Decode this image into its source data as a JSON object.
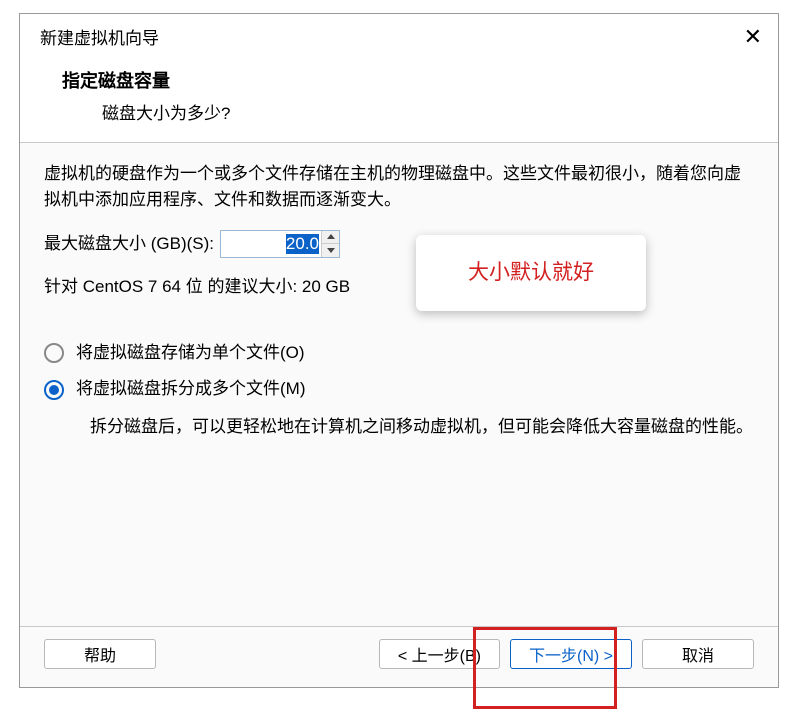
{
  "dialog": {
    "title": "新建虚拟机向导",
    "header_title": "指定磁盘容量",
    "header_subtitle": "磁盘大小为多少?"
  },
  "content": {
    "description": "虚拟机的硬盘作为一个或多个文件存储在主机的物理磁盘中。这些文件最初很小，随着您向虚拟机中添加应用程序、文件和数据而逐渐变大。",
    "size_label": "最大磁盘大小 (GB)(S):",
    "size_value": "20.0",
    "recommend_text": "针对 CentOS 7 64 位 的建议大小: 20 GB",
    "callout_text": "大小默认就好",
    "radio_single": "将虚拟磁盘存储为单个文件(O)",
    "radio_split": "将虚拟磁盘拆分成多个文件(M)",
    "split_desc": "拆分磁盘后，可以更轻松地在计算机之间移动虚拟机，但可能会降低大容量磁盘的性能。"
  },
  "footer": {
    "help": "帮助",
    "back": "< 上一步(B)",
    "next": "下一步(N) >",
    "cancel": "取消"
  }
}
